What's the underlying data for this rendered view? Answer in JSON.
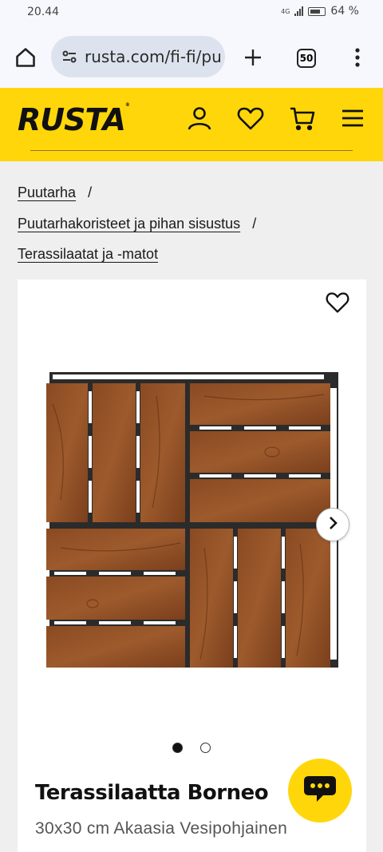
{
  "status_bar": {
    "time": "20.44",
    "network": "4G",
    "battery": "64 %"
  },
  "browser": {
    "url": "rusta.com/fi-fi/pu",
    "tab_count": "50"
  },
  "header": {
    "logo": "RUSTA",
    "accent": "#ffd60a"
  },
  "breadcrumb": [
    {
      "label": "Puutarha"
    },
    {
      "label": "Puutarhakoristeet ja pihan sisustus"
    },
    {
      "label": "Terassilaatat ja -matot"
    }
  ],
  "breadcrumb_separator": "/",
  "product": {
    "title": "Terassilaatta Borneo",
    "subtitle": "30x30 cm Akaasia Vesipohjainen",
    "image_count": 2,
    "active_image": 1
  }
}
